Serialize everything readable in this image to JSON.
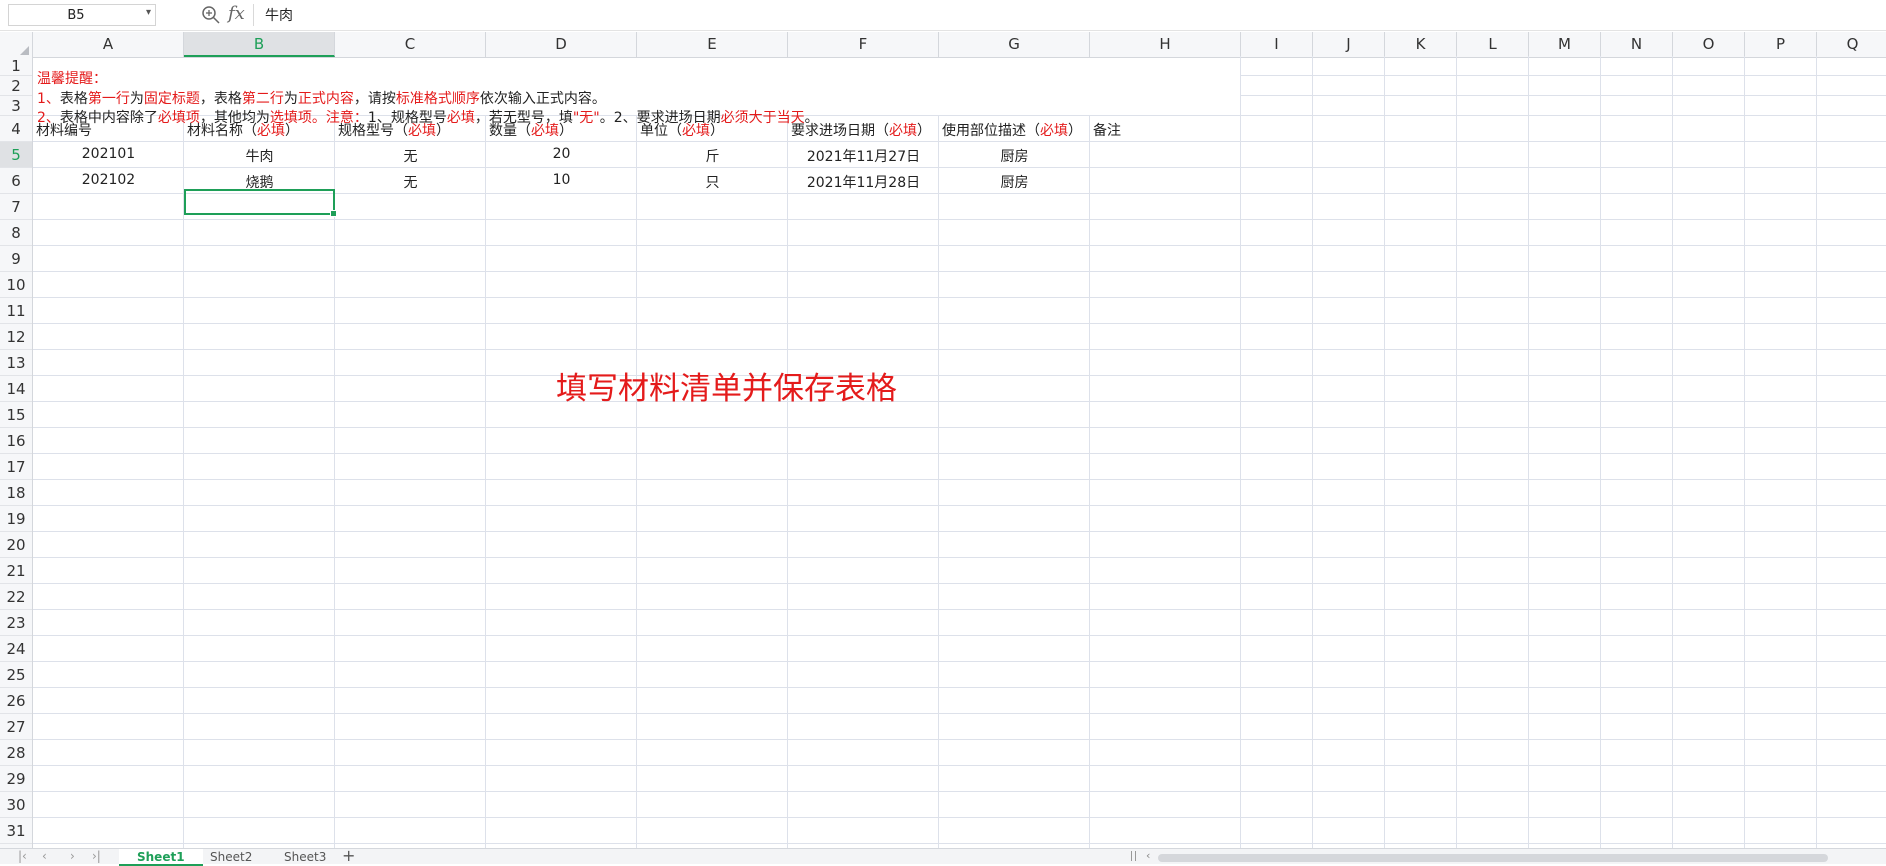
{
  "formula_bar": {
    "name_box": "B5",
    "fx_label": "fx",
    "value": "牛肉"
  },
  "columns": [
    "A",
    "B",
    "C",
    "D",
    "E",
    "F",
    "G",
    "H",
    "I",
    "J",
    "K",
    "L",
    "M",
    "N",
    "O",
    "P",
    "Q"
  ],
  "rows": [
    "1",
    "2",
    "3",
    "4",
    "5",
    "6",
    "7",
    "8",
    "9",
    "10",
    "11",
    "12",
    "13",
    "14",
    "15",
    "16",
    "17",
    "18",
    "19",
    "20",
    "21",
    "22",
    "23",
    "24",
    "25",
    "26",
    "27",
    "28",
    "29",
    "30",
    "31"
  ],
  "reminder": {
    "title": "温馨提醒：",
    "line1": [
      {
        "t": "1、",
        "red": true
      },
      {
        "t": "表格",
        "red": false
      },
      {
        "t": "第一行",
        "red": true
      },
      {
        "t": "为",
        "red": false
      },
      {
        "t": "固定标题",
        "red": true
      },
      {
        "t": "，表格",
        "red": false
      },
      {
        "t": "第二行",
        "red": true
      },
      {
        "t": "为",
        "red": false
      },
      {
        "t": "正式内容",
        "red": true
      },
      {
        "t": "，请按",
        "red": false
      },
      {
        "t": "标准格式顺序",
        "red": true
      },
      {
        "t": "依次输入正式内容。",
        "red": false
      }
    ],
    "line2": [
      {
        "t": "2、",
        "red": true
      },
      {
        "t": "表格中内容除了",
        "red": false
      },
      {
        "t": "必填项",
        "red": true
      },
      {
        "t": "，其他均为",
        "red": false
      },
      {
        "t": "选填项。注意：",
        "red": true
      },
      {
        "t": "1、规格型号",
        "red": false
      },
      {
        "t": "必填",
        "red": true
      },
      {
        "t": "，若无型号，填",
        "red": false
      },
      {
        "t": "\"无\"",
        "red": true
      },
      {
        "t": "。2、要求进场日期",
        "red": false
      },
      {
        "t": "必须大于当天",
        "red": true
      },
      {
        "t": "。",
        "red": false
      }
    ]
  },
  "headers": [
    {
      "col": "A",
      "label": "材料编号",
      "req": ""
    },
    {
      "col": "B",
      "label": "材料名称（",
      "req": "必填",
      "end": "）"
    },
    {
      "col": "C",
      "label": "规格型号（",
      "req": "必填",
      "end": "）"
    },
    {
      "col": "D",
      "label": "数量（",
      "req": "必填",
      "end": "）"
    },
    {
      "col": "E",
      "label": "单位（",
      "req": "必填",
      "end": "）"
    },
    {
      "col": "F",
      "label": "要求进场日期（",
      "req": "必填",
      "end": "）"
    },
    {
      "col": "G",
      "label": "使用部位描述（",
      "req": "必填",
      "end": "）"
    },
    {
      "col": "H",
      "label": "备注",
      "req": ""
    }
  ],
  "data_rows": [
    [
      "202101",
      "牛肉",
      "无",
      "20",
      "斤",
      "2021年11月27日",
      "厨房",
      ""
    ],
    [
      "202102",
      "烧鹅",
      "无",
      "10",
      "只",
      "2021年11月28日",
      "厨房",
      ""
    ]
  ],
  "overlay_text": "填写材料清单并保存表格",
  "sheets": [
    "Sheet1",
    "Sheet2",
    "Sheet3"
  ],
  "active_sheet": "Sheet1",
  "add_sheet": "+",
  "colors": {
    "accent": "#1e9f58",
    "required": "#e41b1b",
    "grid": "#dde1ea"
  }
}
